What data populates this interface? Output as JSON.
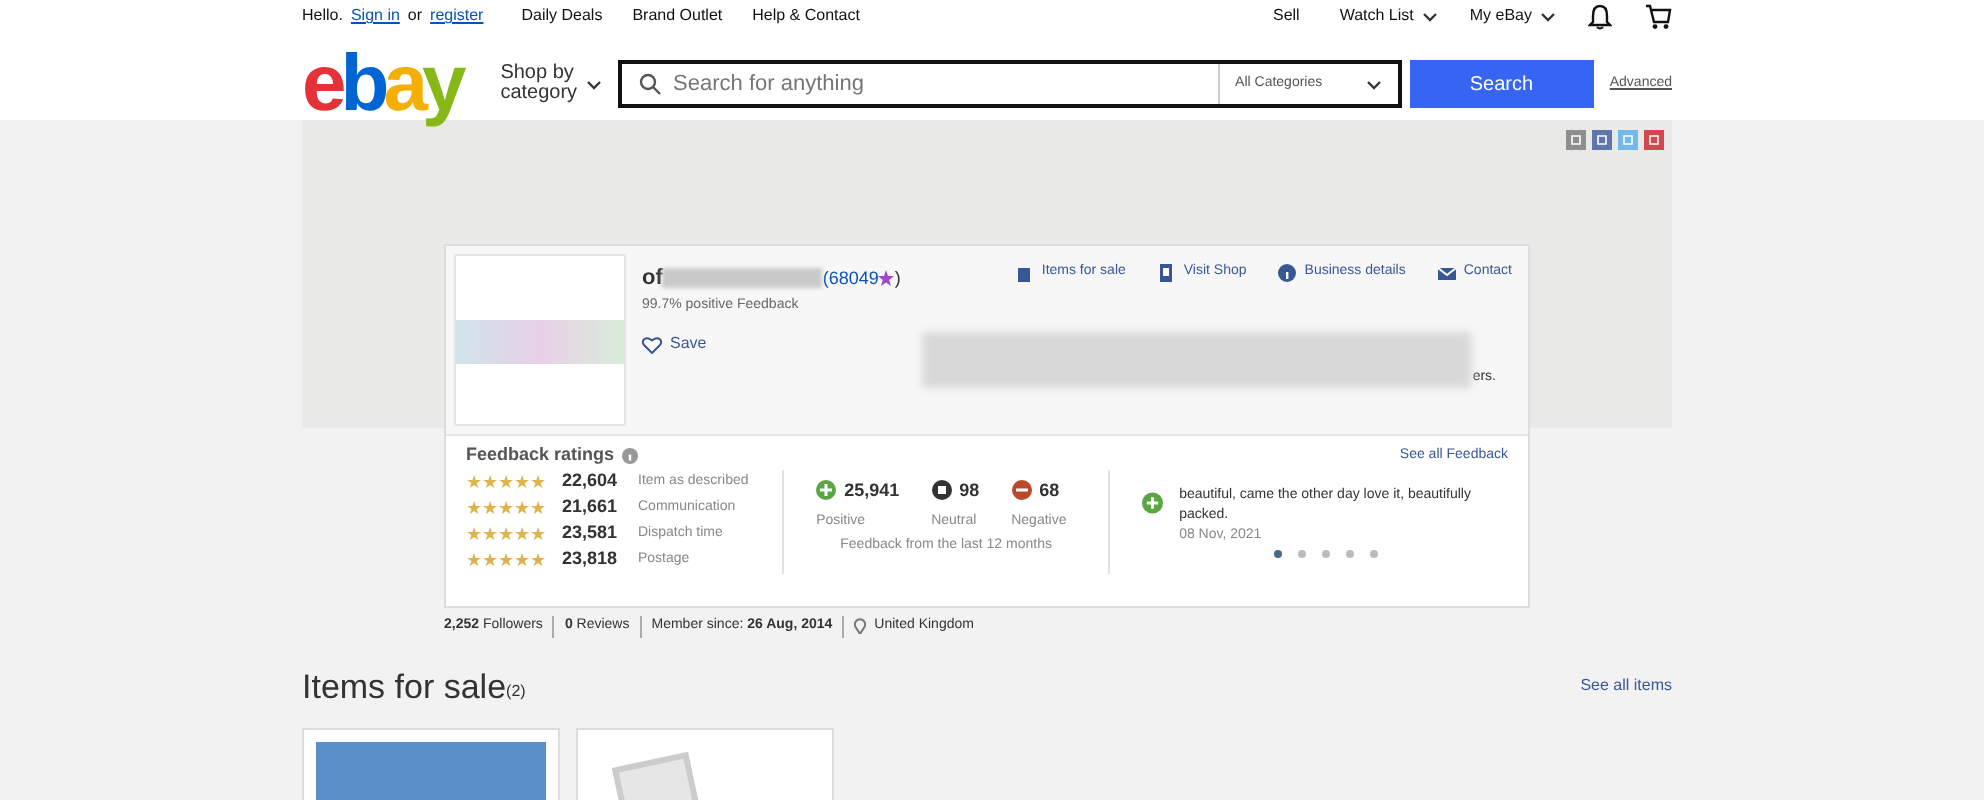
{
  "top_bar": {
    "greeting": "Hello.",
    "sign_in": "Sign in",
    "or": "or",
    "register": "register",
    "links": [
      "Daily Deals",
      "Brand Outlet",
      "Help & Contact"
    ],
    "right_links": [
      {
        "label": "Sell",
        "dropdown": false
      },
      {
        "label": "Watch List",
        "dropdown": true
      },
      {
        "label": "My eBay",
        "dropdown": true
      }
    ]
  },
  "header": {
    "logo_letters": [
      {
        "char": "e",
        "color": "#e53238"
      },
      {
        "char": "b",
        "color": "#0064d2"
      },
      {
        "char": "a",
        "color": "#f5af02"
      },
      {
        "char": "y",
        "color": "#86b817"
      }
    ],
    "shop_by": "Shop by",
    "category": "category",
    "search_placeholder": "Search for anything",
    "category_select": "All Categories",
    "search_button": "Search",
    "advanced": "Advanced"
  },
  "store": {
    "name": "of",
    "feedback_count": "(68049",
    "feedback_close": ")",
    "positive": "99.7% positive Feedback",
    "save": "Save",
    "description_end": "ers.",
    "actions": [
      {
        "kind": "items",
        "label": "Items for sale"
      },
      {
        "kind": "shop",
        "label": "Visit Shop"
      },
      {
        "kind": "info",
        "label": "Business details"
      },
      {
        "kind": "mail",
        "label": "Contact"
      }
    ]
  },
  "ratings": {
    "title": "Feedback ratings",
    "see_all": "See all Feedback",
    "detailed": [
      {
        "stars": 5,
        "count": "22,604",
        "label": "Item as described"
      },
      {
        "stars": 5,
        "count": "21,661",
        "label": "Communication"
      },
      {
        "stars": 5,
        "count": "23,581",
        "label": "Dispatch time"
      },
      {
        "stars": 5,
        "count": "23,818",
        "label": "Postage"
      }
    ],
    "summary": [
      {
        "kind": "positive",
        "count": "25,941",
        "label": "Positive"
      },
      {
        "kind": "neutral",
        "count": "98",
        "label": "Neutral"
      },
      {
        "kind": "negative",
        "count": "68",
        "label": "Negative"
      }
    ],
    "period": "Feedback from the last 12 months",
    "comment": "beautiful, came the other day love it, beautifully packed.",
    "comment_date": "08 Nov, 2021",
    "dots": [
      {
        "selected": true
      },
      {
        "selected": false
      },
      {
        "selected": false
      },
      {
        "selected": false
      },
      {
        "selected": false
      }
    ]
  },
  "stats": [
    "**2,252** Followers",
    "**0** Reviews",
    "Member since: **26 Aug, 2014**"
  ],
  "location": "United Kingdom",
  "items_section": {
    "title": "Items for sale",
    "count": "(2)",
    "see_all": "See all items",
    "items": [
      {
        "kind": "photo"
      },
      {
        "kind": "placeholder"
      }
    ]
  }
}
